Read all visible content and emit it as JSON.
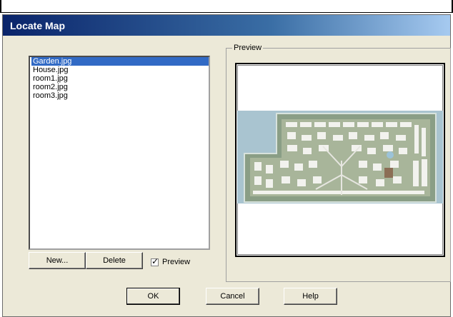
{
  "dialog": {
    "title": "Locate Map"
  },
  "file_list": {
    "items": [
      {
        "label": "Garden.jpg",
        "selected": true
      },
      {
        "label": "House.jpg",
        "selected": false
      },
      {
        "label": "room1.jpg",
        "selected": false
      },
      {
        "label": "room2.jpg",
        "selected": false
      },
      {
        "label": "room3.jpg",
        "selected": false
      }
    ]
  },
  "preview_group": {
    "label": "Preview"
  },
  "buttons": {
    "new_label": "New...",
    "delete_label": "Delete",
    "ok_label": "OK",
    "cancel_label": "Cancel",
    "help_label": "Help"
  },
  "preview_checkbox": {
    "label": "Preview",
    "checked": true
  },
  "colors": {
    "title_start": "#0a246a",
    "title_end": "#a6caf0",
    "selection": "#316ac5",
    "dialog_bg": "#ece9d8"
  }
}
